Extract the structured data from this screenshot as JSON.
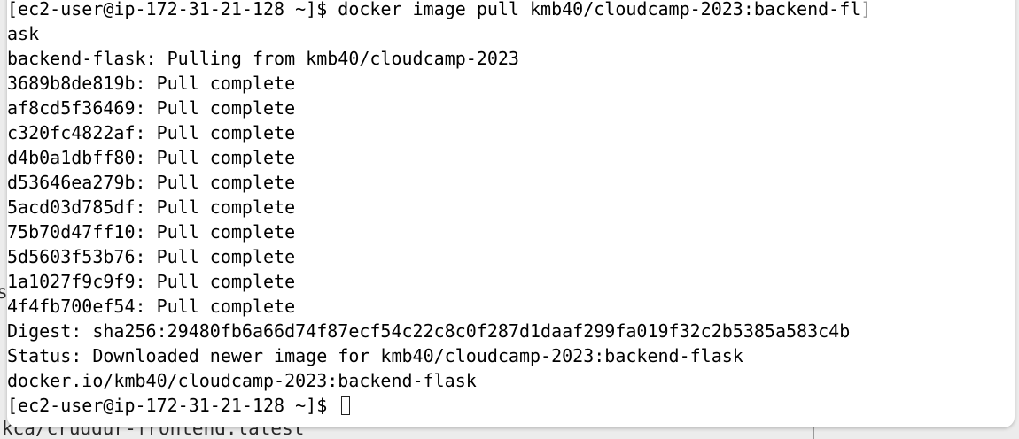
{
  "background_window": {
    "bottom_text": "kca/cruddur-frontend:latest",
    "left_edge_char": "s"
  },
  "terminal": {
    "prompt_prefix": "[ec2-user@ip-172-31-21-128 ~]$ ",
    "command_first": "docker image pull kmb40/cloudcamp-2023:backend-fl",
    "command_wrap": "ask",
    "output": [
      "backend-flask: Pulling from kmb40/cloudcamp-2023",
      "3689b8de819b: Pull complete",
      "af8cd5f36469: Pull complete",
      "c320fc4822af: Pull complete",
      "d4b0a1dbff80: Pull complete",
      "d53646ea279b: Pull complete",
      "5acd03d785df: Pull complete",
      "75b70d47ff10: Pull complete",
      "5d5603f53b76: Pull complete",
      "1a1027f9c9f9: Pull complete",
      "4f4fb700ef54: Pull complete",
      "Digest: sha256:29480fb6a66d74f87ecf54c22c8c0f287d1daaf299fa019f32c2b5385a583c4b",
      "Status: Downloaded newer image for kmb40/cloudcamp-2023:backend-flask",
      "docker.io/kmb40/cloudcamp-2023:backend-flask"
    ],
    "final_prompt": "[ec2-user@ip-172-31-21-128 ~]$ "
  }
}
